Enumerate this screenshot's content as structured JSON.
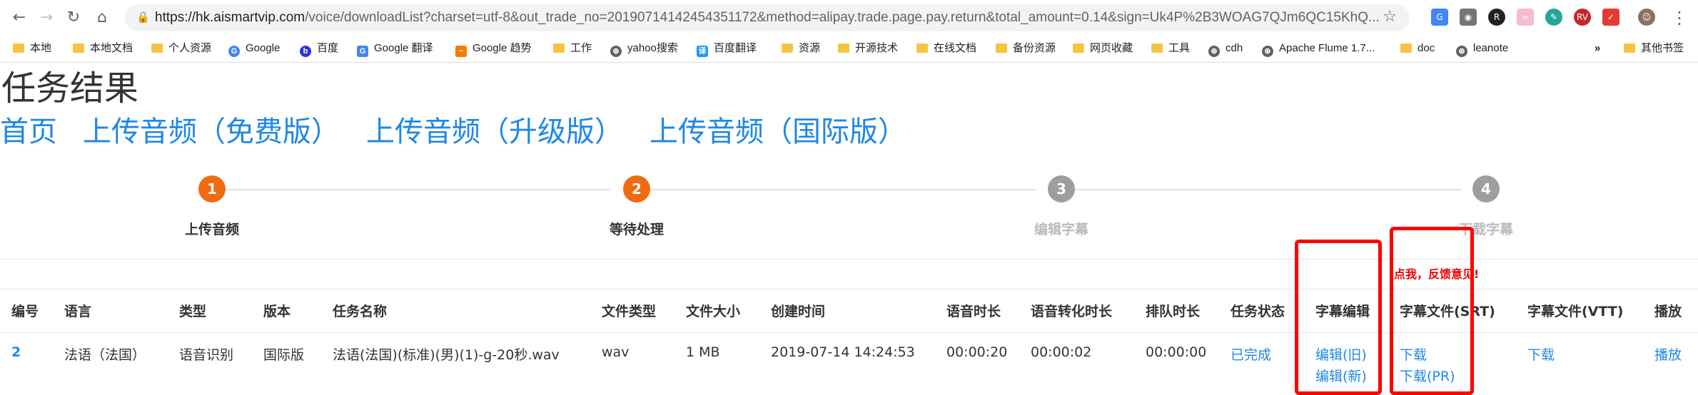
{
  "browser": {
    "url_host": "https://hk.aismartvip.com",
    "url_path": "/voice/downloadList?charset=utf-8&out_trade_no=20190714142454351172&method=alipay.trade.page.pay.return&total_amount=0.14&sign=Uk4P%2B3WOAG7QJm6QC15KhQ...",
    "bookmarks": [
      "本地",
      "本地文档",
      "个人资源",
      "Google",
      "百度",
      "Google 翻译",
      "Google 趋势",
      "工作",
      "yahoo搜索",
      "百度翻译",
      "资源",
      "开源技术",
      "在线文档",
      "备份资源",
      "网页收藏",
      "工具",
      "cdh",
      "Apache Flume 1.7...",
      "doc",
      "leanote",
      "»",
      "其他书签"
    ]
  },
  "page": {
    "title": "任务结果",
    "nav": [
      "首页",
      "上传音频（免费版）",
      "上传音频（升级版）",
      "上传音频（国际版）"
    ]
  },
  "steps": [
    {
      "num": "1",
      "label": "上传音频",
      "active": true
    },
    {
      "num": "2",
      "label": "等待处理",
      "active": true
    },
    {
      "num": "3",
      "label": "编辑字幕",
      "active": false
    },
    {
      "num": "4",
      "label": "下载字幕",
      "active": false
    }
  ],
  "colors": {
    "active": "#f26a0f",
    "inactive": "#9e9e9e",
    "link": "#1e88e5",
    "annotation": "#ff0000"
  },
  "table": {
    "headers": [
      "编号",
      "语言",
      "类型",
      "版本",
      "任务名称",
      "文件类型",
      "文件大小",
      "创建时间",
      "语音时长",
      "语音转化时长",
      "排队时长",
      "任务状态",
      "字幕编辑",
      "字幕文件(SRT)",
      "字幕文件(VTT)",
      "播放"
    ],
    "row": {
      "id": "2",
      "language": "法语（法国）",
      "type": "语音识别",
      "version": "国际版",
      "task_name": "法语(法国)(标准)(男)(1)-g-20秒.wav",
      "file_type": "wav",
      "file_size": "1 MB",
      "created": "2019-07-14 14:24:53",
      "duration": "00:00:20",
      "convert_duration": "00:00:02",
      "queue_duration": "00:00:00",
      "status": "已完成",
      "edit_old": "编辑(旧)",
      "edit_new": "编辑(新)",
      "srt_download": "下载",
      "srt_download_pr": "下载(PR)",
      "vtt_download": "下载",
      "play": "播放"
    }
  },
  "annotation": {
    "text": "点我，反馈意见!"
  }
}
